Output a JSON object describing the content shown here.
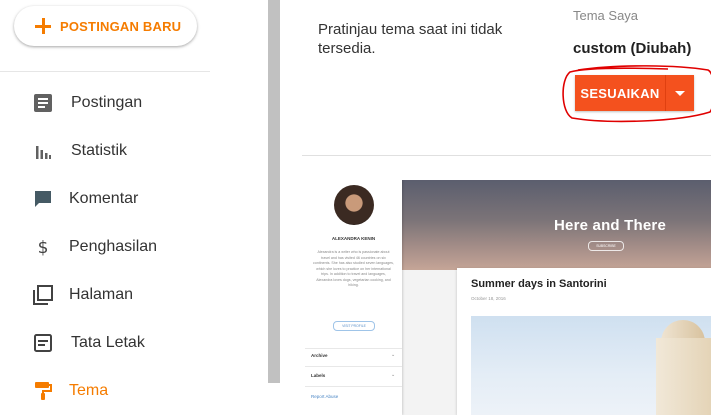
{
  "sidebar": {
    "new_post_label": "POSTINGAN BARU",
    "items": [
      {
        "label": "Postingan",
        "icon": "posts-icon",
        "active": false
      },
      {
        "label": "Statistik",
        "icon": "stats-icon",
        "active": false
      },
      {
        "label": "Komentar",
        "icon": "comment-icon",
        "active": false
      },
      {
        "label": "Penghasilan",
        "icon": "dollar-icon",
        "active": false
      },
      {
        "label": "Halaman",
        "icon": "pages-icon",
        "active": false
      },
      {
        "label": "Tata Letak",
        "icon": "layout-icon",
        "active": false
      },
      {
        "label": "Tema",
        "icon": "paint-roller-icon",
        "active": true
      }
    ]
  },
  "main": {
    "preview_message": "Pratinjau tema saat ini tidak tersedia.",
    "theme_label": "Tema Saya",
    "theme_name": "custom (Diubah)",
    "customize_label": "SESUAIKAN"
  },
  "thumbnail": {
    "author": "ALEXANDRA KENIN",
    "bio": "Alexandra is a writer who is passionate about travel and has visited 46 countries on six continents. She has also studied seven languages, which she loves to practice on her international trips. In addition to travel and languages, Alexandra loves dogs, vegetarian cooking, and hiking.",
    "visit_profile": "VISIT PROFILE",
    "archive": "Archive",
    "labels": "Labels",
    "report_abuse": "Report Abuse",
    "blog_title": "Here and There",
    "subscribe": "SUBSCRIBE",
    "post_title": "Summer days in Santorini",
    "post_date": "October 18, 2016"
  },
  "colors": {
    "accent": "#f57c00",
    "button": "#f4511e",
    "annotation": "#e53935"
  }
}
